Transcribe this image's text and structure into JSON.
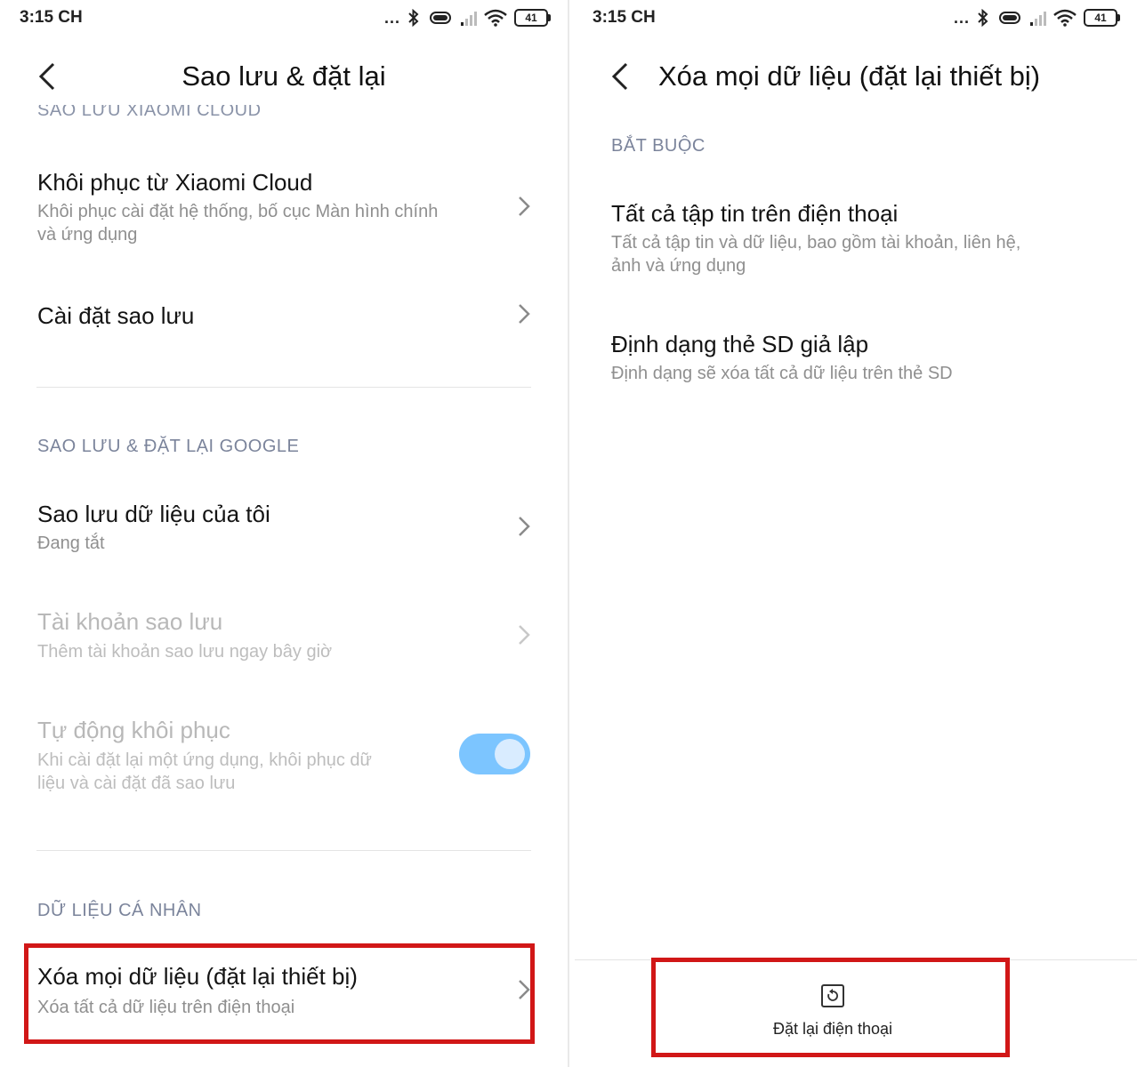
{
  "status_bar": {
    "time": "3:15 CH",
    "dots": "...",
    "battery": "41"
  },
  "left": {
    "title": "Sao lưu & đặt lại",
    "cut_section_label": "SAO LƯU XIAOMI CLOUD",
    "items": [
      {
        "title": "Khôi phục từ Xiaomi Cloud",
        "sub_line1": "Khôi phục cài đặt hệ thống, bố cục Màn hình chính",
        "sub_line2": "và ứng dụng"
      },
      {
        "title": "Cài đặt sao lưu"
      }
    ],
    "google_section_label": "SAO LƯU & ĐẶT LẠI GOOGLE",
    "google_items": [
      {
        "title": "Sao lưu dữ liệu của tôi",
        "sub": "Đang tắt"
      },
      {
        "title": "Tài khoản sao lưu",
        "sub": "Thêm tài khoản sao lưu ngay bây giờ"
      },
      {
        "title": "Tự động khôi phục",
        "sub_line1": "Khi cài đặt lại một ứng dụng, khôi phục dữ",
        "sub_line2": "liệu và cài đặt đã sao lưu",
        "toggle_on": true
      }
    ],
    "personal_section_label": "DỮ LIỆU CÁ NHÂN",
    "personal_items": [
      {
        "title": "Xóa mọi dữ liệu (đặt lại thiết bị)",
        "sub": "Xóa tất cả dữ liệu trên điện thoại"
      }
    ]
  },
  "right": {
    "title": "Xóa mọi dữ liệu (đặt lại thiết bị)",
    "section_label": "BẮT BUỘC",
    "items": [
      {
        "title": "Tất cả tập tin trên điện thoại",
        "sub_line1": "Tất cả tập tin và dữ liệu, bao gồm tài khoản, liên hệ,",
        "sub_line2": "ảnh và ứng dụng"
      },
      {
        "title": "Định dạng thẻ SD giả lập",
        "sub": "Định dạng sẽ xóa tất cả dữ liệu trên thẻ SD"
      }
    ],
    "reset_button_label": "Đặt lại điện thoại"
  },
  "colors": {
    "highlight": "#d11717",
    "toggle_on": "#7cc5ff",
    "section_label": "#7b849b"
  }
}
